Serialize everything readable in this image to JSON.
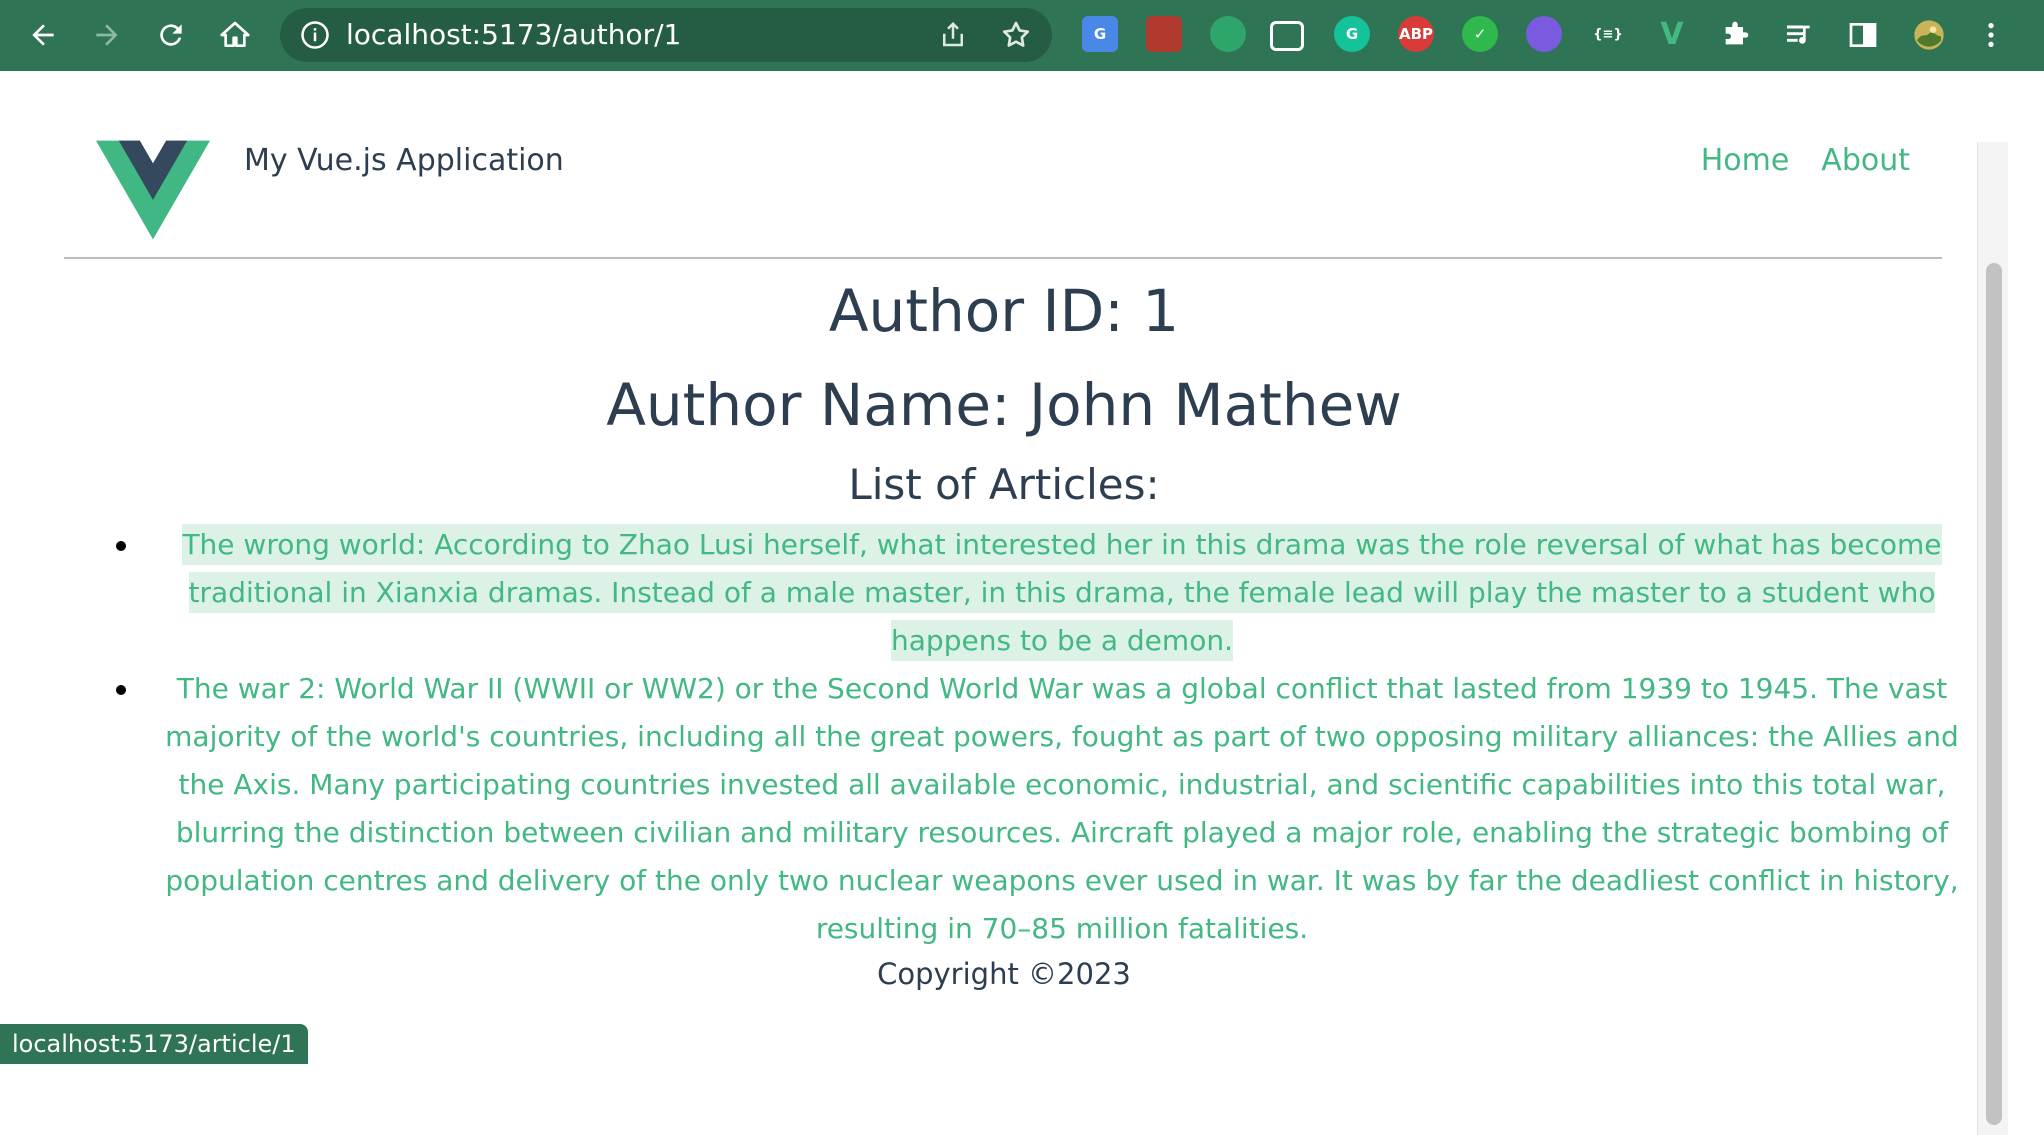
{
  "browser": {
    "url": "localhost:5173/author/1",
    "status_url": "localhost:5173/article/1",
    "extensions": [
      {
        "name": "google-translate-icon",
        "label": "G",
        "color": "#4a88e8"
      },
      {
        "name": "shield-extension-icon",
        "label": "",
        "color": "#b03a2e"
      },
      {
        "name": "sync-extension-icon",
        "label": "",
        "color": "#2ea56b"
      },
      {
        "name": "picture-in-picture-icon",
        "label": "",
        "color": "#ffffff"
      },
      {
        "name": "grammarly-icon",
        "label": "G",
        "color": "#15c39a"
      },
      {
        "name": "adblock-plus-icon",
        "label": "ABP",
        "color": "#d93a3a"
      },
      {
        "name": "check-extension-icon",
        "label": "✓",
        "color": "#2fb84c"
      },
      {
        "name": "color-picker-icon",
        "label": "",
        "color": "#7a5be0"
      },
      {
        "name": "json-viewer-icon",
        "label": "{≡}",
        "color": "#2f7555"
      },
      {
        "name": "vue-devtools-icon",
        "label": "V",
        "color": "#42b883"
      }
    ]
  },
  "header": {
    "app_title": "My Vue.js Application",
    "nav": [
      "Home",
      "About"
    ]
  },
  "author": {
    "id_line": "Author ID: 1",
    "name_line": "Author Name: John Mathew",
    "list_title": "List of Articles:"
  },
  "articles": [
    {
      "text": "The wrong world: According to Zhao Lusi herself, what interested her in this drama was the role reversal of what has become traditional in Xianxia dramas. Instead of a male master, in this drama, the female lead will play the master to a student who happens to be a demon.",
      "hovered": true
    },
    {
      "text": "The war 2: World War II (WWII or WW2) or the Second World War was a global conflict that lasted from 1939 to 1945. The vast majority of the world's countries, including all the great powers, fought as part of two opposing military alliances: the Allies and the Axis. Many participating countries invested all available economic, industrial, and scientific capabilities into this total war, blurring the distinction between civilian and military resources. Aircraft played a major role, enabling the strategic bombing of population centres and delivery of the only two nuclear weapons ever used in war. It was by far the deadliest conflict in history, resulting in 70–85 million fatalities.",
      "hovered": false
    }
  ],
  "footer": {
    "copyright": "Copyright ©2023"
  },
  "colors": {
    "toolbar": "#2f7555",
    "accent": "#42b883",
    "text": "#2c3e50",
    "hover_bg": "#dcf2e6"
  }
}
